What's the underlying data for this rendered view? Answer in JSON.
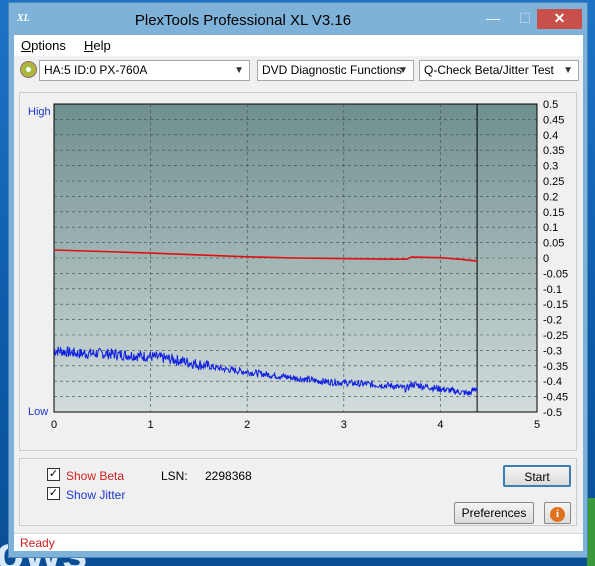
{
  "window": {
    "title": "PlexTools Professional XL V3.16",
    "app_icon": "XL",
    "min_glyph": "—",
    "max_glyph": "☐",
    "close_glyph": "✕"
  },
  "menu": {
    "options": "Options",
    "help": "Help"
  },
  "toolbar": {
    "drive": "HA:5 ID:0  PX-760A",
    "function": "DVD Diagnostic Functions",
    "test": "Q-Check Beta/Jitter Test",
    "arrow": "▼"
  },
  "chart_labels": {
    "high": "High",
    "low": "Low"
  },
  "chart_data": {
    "type": "line",
    "xlim": [
      0,
      5
    ],
    "x_ticks": [
      "0",
      "1",
      "2",
      "3",
      "4",
      "5"
    ],
    "ylim": [
      -0.5,
      0.5
    ],
    "y_ticks": [
      "0.5",
      "0.45",
      "0.4",
      "0.35",
      "0.3",
      "0.25",
      "0.2",
      "0.15",
      "0.1",
      "0.05",
      "0",
      "-0.05",
      "-0.1",
      "-0.15",
      "-0.2",
      "-0.25",
      "-0.3",
      "-0.35",
      "-0.4",
      "-0.45",
      "-0.5"
    ],
    "grid": true,
    "end_marker_x": 4.38,
    "colors": {
      "beta": "#e01010",
      "jitter": "#1020e0",
      "plot_bg_top": "#6f8e8e",
      "plot_bg_bottom": "#d2dcdc"
    },
    "series": [
      {
        "name": "Beta",
        "x": [
          0,
          0.5,
          1,
          1.5,
          2,
          2.5,
          3,
          3.5,
          3.65,
          3.7,
          4,
          4.2,
          4.38
        ],
        "values": [
          0.026,
          0.021,
          0.016,
          0.01,
          0.004,
          0.0,
          -0.002,
          -0.004,
          -0.004,
          0.003,
          0.001,
          -0.004,
          -0.01
        ]
      },
      {
        "name": "Jitter",
        "x": [
          0,
          0.25,
          0.5,
          0.75,
          1,
          1.25,
          1.5,
          1.75,
          2,
          2.25,
          2.5,
          2.75,
          3,
          3.25,
          3.5,
          3.65,
          3.7,
          3.9,
          4.1,
          4.3,
          4.38
        ],
        "values": [
          -0.3,
          -0.31,
          -0.31,
          -0.315,
          -0.32,
          -0.33,
          -0.345,
          -0.36,
          -0.37,
          -0.38,
          -0.39,
          -0.4,
          -0.405,
          -0.41,
          -0.415,
          -0.425,
          -0.41,
          -0.42,
          -0.43,
          -0.44,
          -0.42
        ]
      }
    ]
  },
  "bottom": {
    "show_beta": "Show Beta",
    "show_jitter": "Show Jitter",
    "check_mark": "✓",
    "lsn_label": "LSN:",
    "lsn_value": "2298368",
    "start": "Start",
    "preferences": "Preferences",
    "info_glyph": "i"
  },
  "status": {
    "text": "Ready"
  },
  "desktop": {
    "text": "ows"
  }
}
